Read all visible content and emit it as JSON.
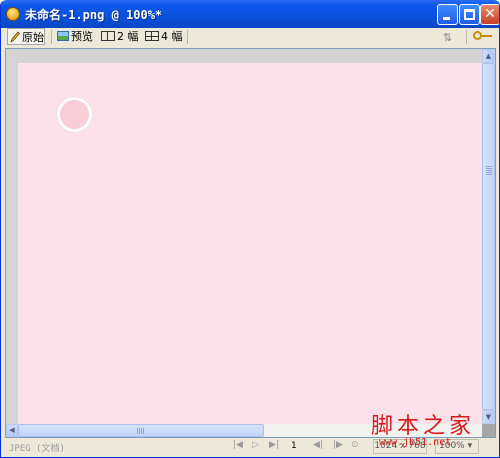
{
  "window": {
    "title": "未命名-1.png @ 100%*",
    "close_glyph": "✕"
  },
  "toolbar": {
    "original_label": "原始",
    "preview_label": "预览",
    "two_up_label": "2 幅",
    "four_up_label": "4 幅",
    "icons": [
      "pencil-icon",
      "preview-icon",
      "two-up-icon",
      "four-up-icon",
      "arrows-icon",
      "key-icon"
    ]
  },
  "canvas": {
    "background_color": "#fde1ea",
    "circle_fill": "#f8cdd8",
    "circle_stroke": "#ffffff"
  },
  "scrollbars": {
    "up_glyph": "▲",
    "down_glyph": "▼",
    "left_glyph": "◀"
  },
  "statusbar": {
    "format": "JPEG (文档)",
    "nav_first": "|◀",
    "nav_play": "▷",
    "nav_last": "▶|",
    "page": "1",
    "nav_prev": "◀|",
    "nav_next": "|▶",
    "nav_loop": "⊙",
    "size": "1024 x 768",
    "zoom": "100%  ▾"
  },
  "watermark": {
    "title": "脚本之家",
    "url": "www.jb51.net"
  }
}
